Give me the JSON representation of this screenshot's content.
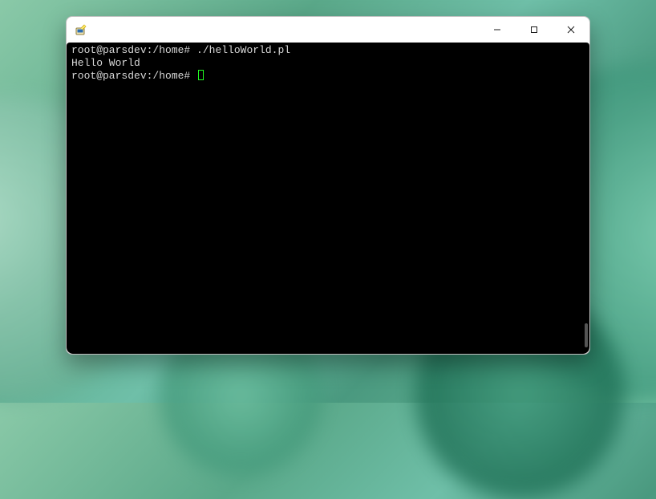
{
  "window": {
    "app_icon": "putty-icon"
  },
  "terminal": {
    "lines": [
      {
        "prompt": "root@parsdev:/home#",
        "command": " ./helloWorld.pl"
      },
      {
        "output": "Hello World"
      },
      {
        "prompt": "root@parsdev:/home#",
        "command": "",
        "cursor": true
      }
    ]
  }
}
